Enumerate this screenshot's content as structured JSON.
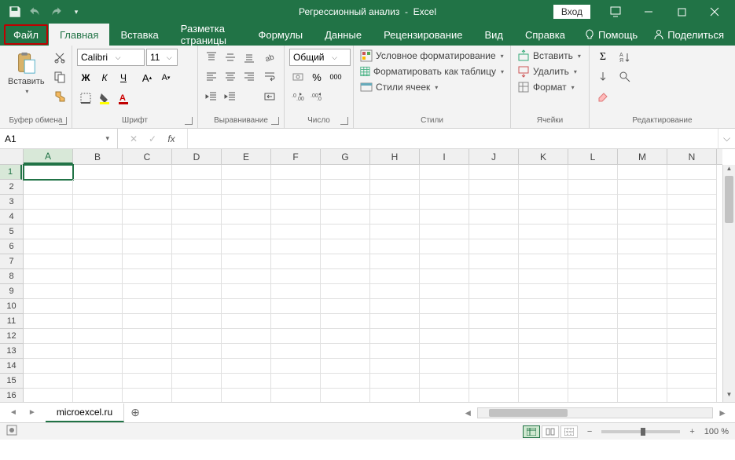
{
  "titlebar": {
    "title_doc": "Регрессионный анализ",
    "title_app": "Excel",
    "login": "Вход"
  },
  "tabs": {
    "file": "Файл",
    "home": "Главная",
    "insert": "Вставка",
    "layout": "Разметка страницы",
    "formulas": "Формулы",
    "data": "Данные",
    "review": "Рецензирование",
    "view": "Вид",
    "help": "Справка",
    "tellme": "Помощь",
    "share": "Поделиться"
  },
  "ribbon": {
    "clipboard": {
      "label": "Буфер обмена",
      "paste": "Вставить"
    },
    "font": {
      "label": "Шрифт",
      "name": "Calibri",
      "size": "11",
      "bold": "Ж",
      "italic": "К",
      "underline": "Ч"
    },
    "alignment": {
      "label": "Выравнивание"
    },
    "number": {
      "label": "Число",
      "format": "Общий",
      "percent": "%",
      "thousands": "000"
    },
    "styles": {
      "label": "Стили",
      "conditional": "Условное форматирование",
      "table": "Форматировать как таблицу",
      "cell": "Стили ячеек"
    },
    "cells": {
      "label": "Ячейки",
      "insert": "Вставить",
      "delete": "Удалить",
      "format": "Формат"
    },
    "editing": {
      "label": "Редактирование"
    }
  },
  "formula_bar": {
    "name_box": "A1",
    "fx": "fx",
    "value": ""
  },
  "grid": {
    "columns": [
      "A",
      "B",
      "C",
      "D",
      "E",
      "F",
      "G",
      "H",
      "I",
      "J",
      "K",
      "L",
      "M",
      "N"
    ],
    "rows": [
      1,
      2,
      3,
      4,
      5,
      6,
      7,
      8,
      9,
      10,
      11,
      12,
      13,
      14,
      15,
      16
    ],
    "selected_cell": "A1",
    "active_col": 0,
    "active_row": 0
  },
  "sheets": {
    "active": "microexcel.ru"
  },
  "statusbar": {
    "zoom": "100 %",
    "minus": "−",
    "plus": "+"
  }
}
